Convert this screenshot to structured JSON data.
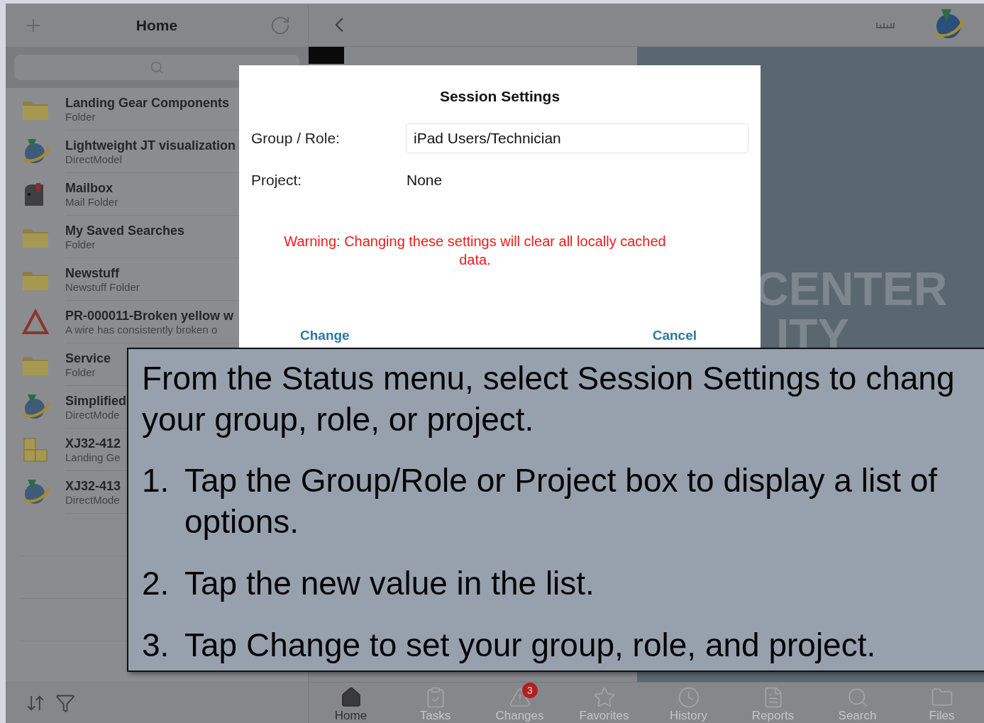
{
  "sidebar": {
    "title": "Home",
    "items": [
      {
        "kind": "folder",
        "title": "Landing Gear Components",
        "subtitle": "Folder"
      },
      {
        "kind": "model",
        "title": "Lightweight JT visualization",
        "subtitle": "DirectModel"
      },
      {
        "kind": "mailbox",
        "title": "Mailbox",
        "subtitle": "Mail Folder"
      },
      {
        "kind": "folder",
        "title": "My Saved Searches",
        "subtitle": "Folder"
      },
      {
        "kind": "folder",
        "title": "Newstuff",
        "subtitle": "Newstuff Folder"
      },
      {
        "kind": "problem",
        "title": "PR-000011-Broken yellow w",
        "subtitle": "A wire has consistently broken o"
      },
      {
        "kind": "folder",
        "title": "Service",
        "subtitle": "Folder"
      },
      {
        "kind": "model",
        "title": "Simplified",
        "subtitle": "DirectMode"
      },
      {
        "kind": "part",
        "title": "XJ32-412",
        "subtitle": "Landing Ge"
      },
      {
        "kind": "model",
        "title": "XJ32-413",
        "subtitle": "DirectMode"
      }
    ]
  },
  "background_text": [
    "CENTER",
    "ITY"
  ],
  "dialog": {
    "title": "Session Settings",
    "group_role_label": "Group / Role:",
    "group_role_value": "iPad Users/Technician",
    "project_label": "Project:",
    "project_value": "None",
    "warning": "Warning: Changing these settings will clear all locally cached data.",
    "buttons": [
      "Change",
      "Cancel"
    ]
  },
  "tab_bar": [
    {
      "label": "Home",
      "kind": "home",
      "selected": true
    },
    {
      "label": "Tasks",
      "kind": "tasks",
      "selected": false
    },
    {
      "label": "Changes",
      "kind": "changes",
      "selected": false,
      "badge": "3"
    },
    {
      "label": "Favorites",
      "kind": "favorites",
      "selected": false
    },
    {
      "label": "History",
      "kind": "history",
      "selected": false
    },
    {
      "label": "Reports",
      "kind": "reports",
      "selected": false
    },
    {
      "label": "Search",
      "kind": "search",
      "selected": false
    },
    {
      "label": "Files",
      "kind": "files",
      "selected": false
    }
  ],
  "callout": {
    "intro_lines": [
      "From the Status menu, select Session Settings to chang",
      "your group, role, or project."
    ],
    "steps": [
      {
        "number": "1.",
        "text": "Tap the Group/Role or Project box to display a list of options."
      },
      {
        "number": "2.",
        "text": "Tap the new value in the list."
      },
      {
        "number": "3.",
        "text": "Tap Change to set your group, role, and project."
      }
    ]
  }
}
